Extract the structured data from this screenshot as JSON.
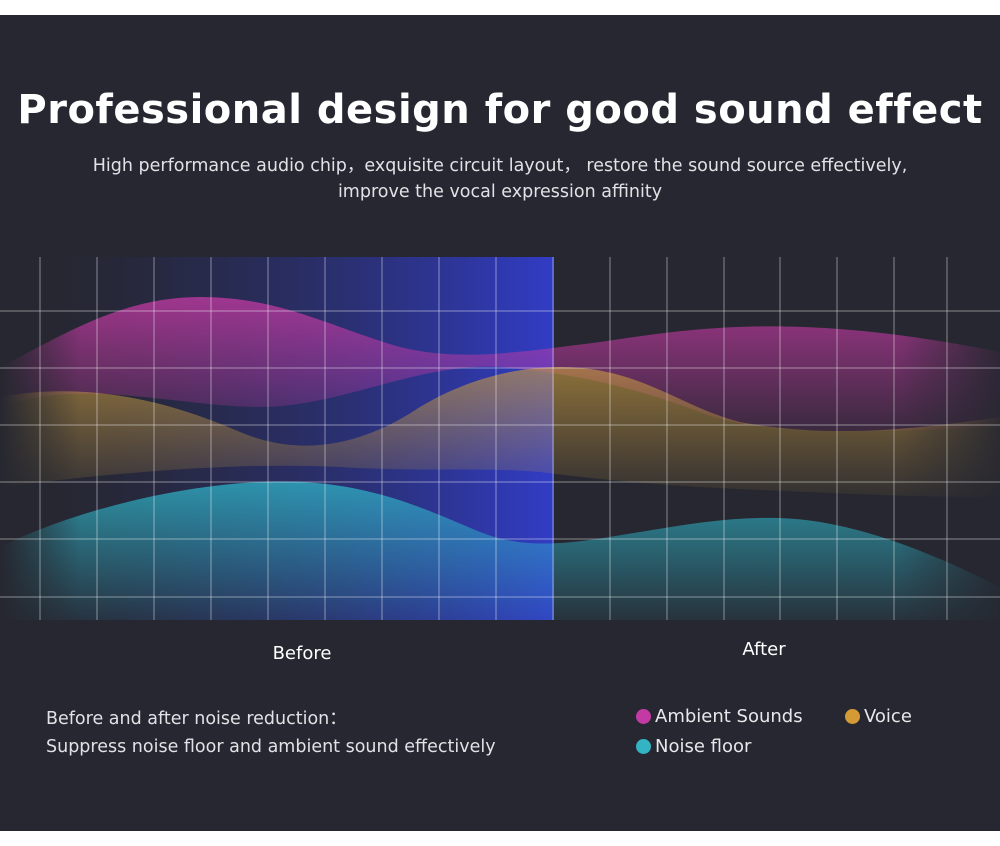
{
  "title": "Professional design for good sound effect",
  "subtitle_line1": "High performance audio chip，exquisite circuit  layout，  restore the sound source effectively,",
  "subtitle_line2": "improve the vocal expression affinity",
  "labels": {
    "before": "Before",
    "after": "After"
  },
  "note_line1": "Before and after noise reduction：",
  "note_line2": "Suppress noise floor and ambient sound effectively",
  "legend": [
    {
      "label": "Ambient Sounds",
      "color": "#c43aa4"
    },
    {
      "label": "Voice",
      "color": "#d49a35"
    },
    {
      "label": "Noise floor",
      "color": "#33b3c4"
    }
  ],
  "colors": {
    "background": "#262730",
    "ambient": "#c43aa4",
    "voice": "#c79a40",
    "noise": "#2fb2c6",
    "before_highlight": "#3340e0"
  }
}
